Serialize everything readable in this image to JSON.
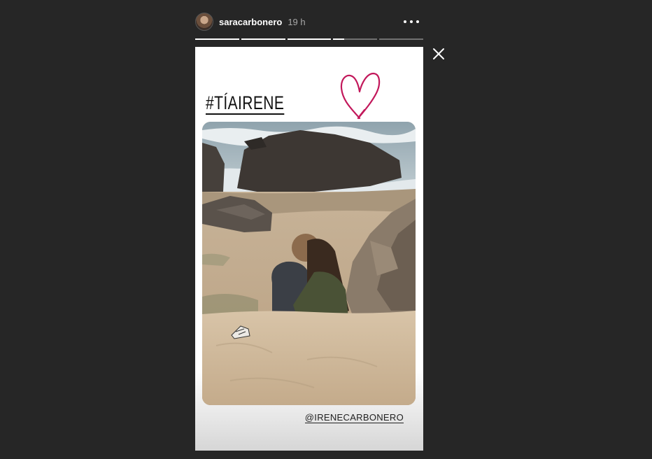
{
  "header": {
    "username": "saracarbonero",
    "time": "19 h",
    "more_icon": "more-horizontal-icon"
  },
  "progress": [
    {
      "fill": 1.0
    },
    {
      "fill": 1.0
    },
    {
      "fill": 1.0
    },
    {
      "fill": 0.25
    },
    {
      "fill": 0.0
    }
  ],
  "close_icon": "close-icon",
  "story": {
    "hashtag": "#TÍAIRENE",
    "mention": "@IRENECARBONERO",
    "heart_color": "#c2185b",
    "heart_icon": "heart-doodle-icon"
  }
}
